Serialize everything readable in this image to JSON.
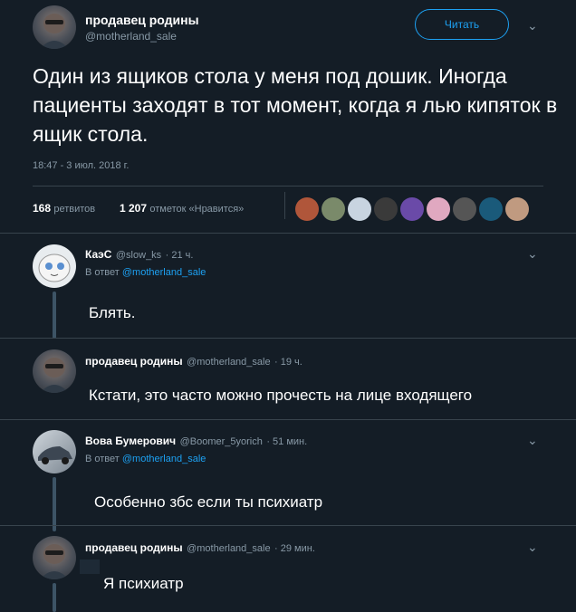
{
  "main_tweet": {
    "author_name": "продавец родины",
    "author_handle": "@motherland_sale",
    "follow_label": "Читать",
    "text": "Один из ящиков стола у меня под дошик. Иногда пациенты заходят в тот момент, когда я лью кипяток в ящик стола.",
    "timestamp": "18:47 - 3 июл. 2018 г.",
    "retweets_count": "168",
    "retweets_label": "ретвитов",
    "likes_count": "1 207",
    "likes_label": "отметок «Нравится»"
  },
  "replies": [
    {
      "author_name": "КаэС",
      "author_handle": "@slow_ks",
      "time": "· 21 ч.",
      "reply_to_prefix": "В ответ",
      "reply_to": "@motherland_sale",
      "text": "Блять."
    },
    {
      "author_name": "продавец родины",
      "author_handle": "@motherland_sale",
      "time": "· 19 ч.",
      "text": "Кстати, это часто можно прочесть на лице входящего"
    },
    {
      "author_name": "Вова Бумерович",
      "author_handle": "@Boomer_5yorich",
      "time": "· 51 мин.",
      "reply_to_prefix": "В ответ",
      "reply_to": "@motherland_sale",
      "text": "Особенно збс если ты психиатр"
    },
    {
      "author_name": "продавец родины",
      "author_handle": "@motherland_sale",
      "time": "· 29 мин.",
      "text": "Я психиатр"
    }
  ],
  "colors": {
    "background": "#141d26",
    "accent": "#1da1f2",
    "muted": "#8899a6",
    "divider": "#38444d",
    "thread": "#3d5466"
  }
}
